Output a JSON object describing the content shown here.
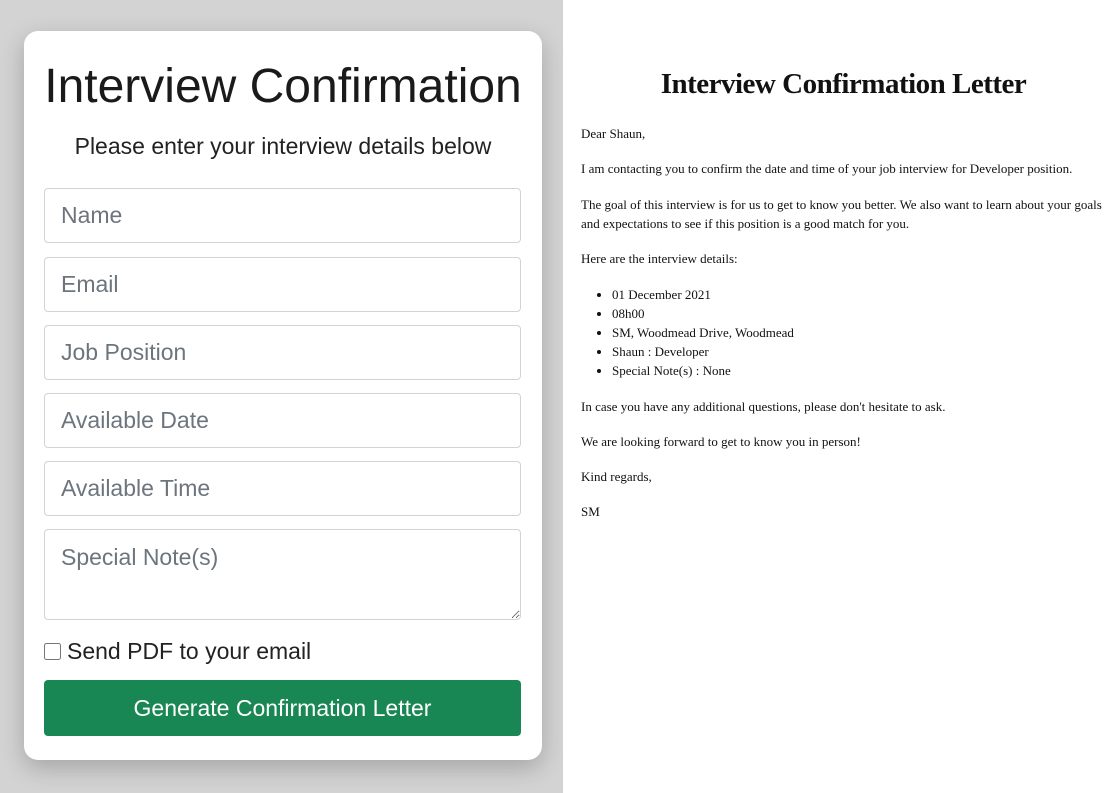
{
  "form": {
    "title": "Interview Confirmation",
    "subtitle": "Please enter your interview details below",
    "fields": {
      "name_placeholder": "Name",
      "email_placeholder": "Email",
      "job_position_placeholder": "Job Position",
      "available_date_placeholder": "Available Date",
      "available_time_placeholder": "Available Time",
      "special_notes_placeholder": "Special Note(s)"
    },
    "send_pdf_label": "Send PDF to your email",
    "send_pdf_checked": false,
    "generate_button_label": "Generate Confirmation Letter",
    "generate_button_color": "#198754"
  },
  "letter": {
    "title": "Interview Confirmation Letter",
    "greeting": "Dear Shaun,",
    "para1": "I am contacting you to confirm the date and time of your job interview for Developer position.",
    "para2": "The goal of this interview is for us to get to know you better. We also want to learn about your goals and expectations to see if this position is a good match for you.",
    "details_intro": "Here are the interview details:",
    "details": [
      "01 December 2021",
      "08h00",
      "SM, Woodmead Drive, Woodmead",
      "Shaun : Developer",
      "Special Note(s) : None"
    ],
    "para3": "In case you have any additional questions, please don't hesitate to ask.",
    "para4": "We are looking forward to get to know you in person!",
    "closing": "Kind regards,",
    "signature": "SM"
  }
}
